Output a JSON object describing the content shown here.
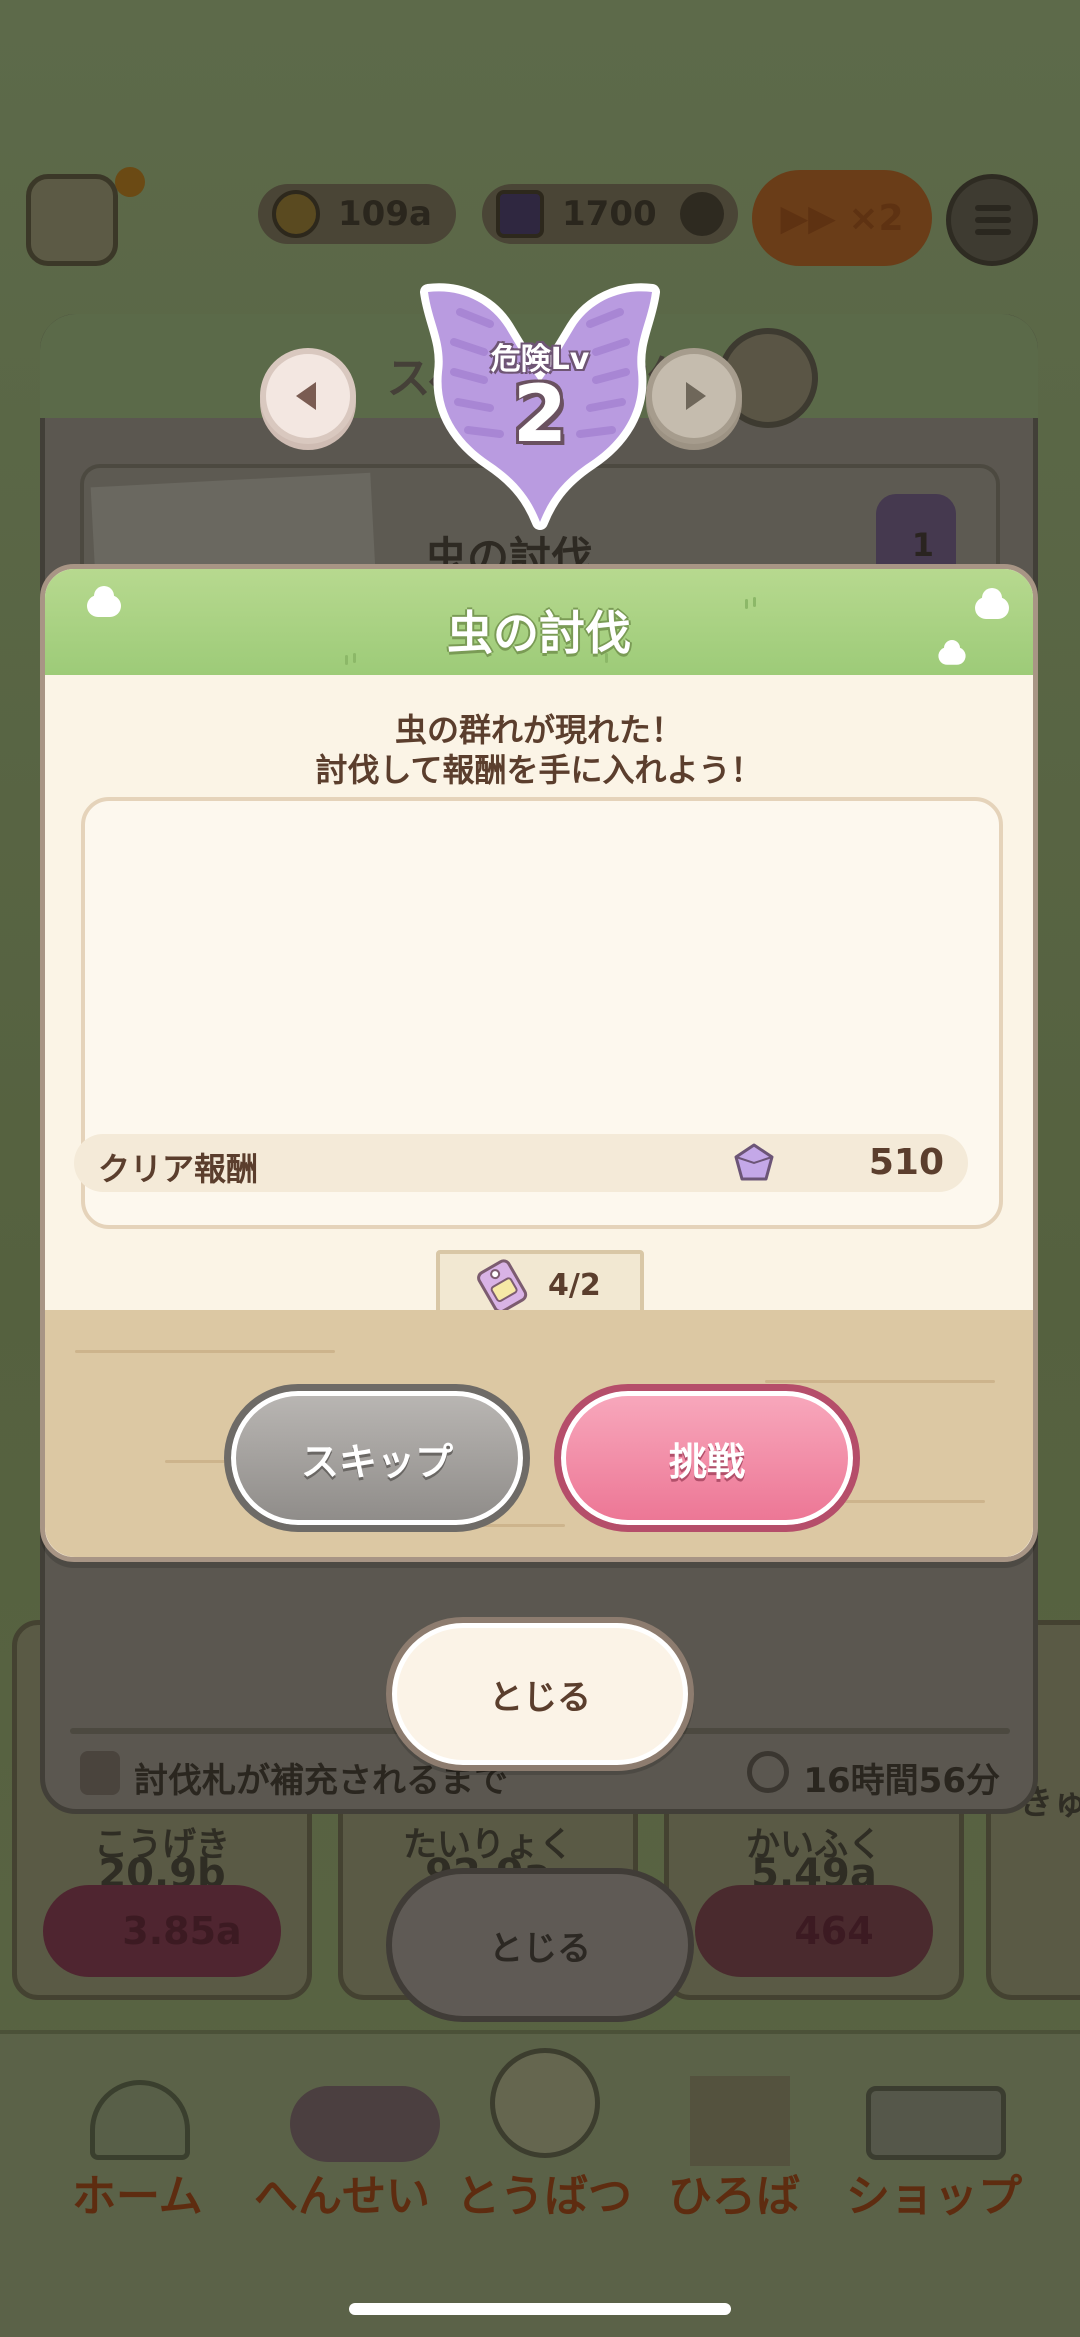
{
  "hud": {
    "coins": "109a",
    "gems": "1700",
    "speed": "▶▶ ×2"
  },
  "background_panel": {
    "title": "スペシャル討伐",
    "card_title": "虫の討伐",
    "card_level": "1",
    "refill_label": "討伐札が補充されるまで",
    "refill_time": "16時間56分",
    "close_label": "とじる"
  },
  "stats": [
    {
      "name": "こうげき",
      "value": "20.9b",
      "cost": "3.85a"
    },
    {
      "name": "たいりょく",
      "value": "92.9a",
      "cost": ""
    },
    {
      "name": "かいふく",
      "value": "5.49a",
      "cost": "464"
    },
    {
      "name": "きゅ",
      "value": "",
      "cost": ""
    }
  ],
  "outer_close_label": "とじる",
  "nav": {
    "home": "ホーム",
    "formation": "へんせい",
    "hunt": "とうばつ",
    "plaza": "ひろば",
    "shop": "ショップ"
  },
  "dialog": {
    "title": "虫の討伐",
    "message_line1": "虫の群れが現れた！",
    "message_line2": "討伐して報酬を手に入れよう！",
    "danger_label": "危険Lv",
    "danger_level": "2",
    "reward_label": "クリア報酬",
    "reward_value": "510",
    "ticket_count": "4/2",
    "skip_label": "スキップ",
    "challenge_label": "挑戦"
  },
  "colors": {
    "header_green": "#9dcb78",
    "dialog_bg": "#fbf4e6",
    "challenge_pink": "#ec7594",
    "skip_gray": "#8e8b88",
    "badge_purple": "#b99be0",
    "text_brown": "#5b3e2d"
  },
  "icons": {
    "prev": "chevron-left-icon",
    "next": "chevron-right-icon",
    "gem": "gem-icon",
    "ticket": "ticket-icon",
    "timer": "stopwatch-icon",
    "bulb": "lightbulb-icon",
    "info": "info-icon",
    "menu": "menu-icon",
    "coin": "coin-icon"
  }
}
